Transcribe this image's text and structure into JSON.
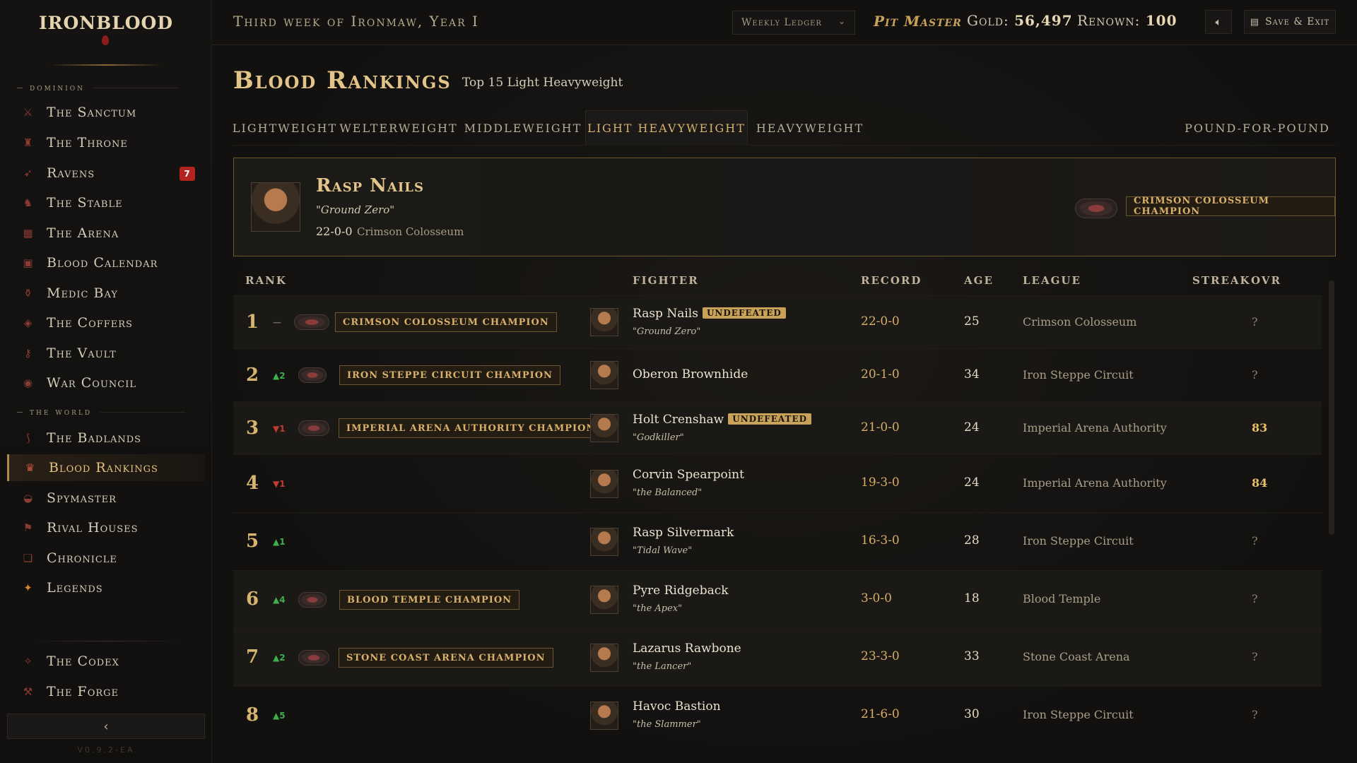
{
  "sidebar": {
    "logo": "IRONBLOOD",
    "sections": [
      {
        "label": "dominion"
      },
      {
        "label": "the world"
      }
    ],
    "items": [
      {
        "label": "The Sanctum",
        "icon": "crossed-swords-icon"
      },
      {
        "label": "The Throne",
        "icon": "throne-icon"
      },
      {
        "label": "Ravens",
        "icon": "raven-icon",
        "badge": "7"
      },
      {
        "label": "The Stable",
        "icon": "horse-icon"
      },
      {
        "label": "The Arena",
        "icon": "arena-icon"
      },
      {
        "label": "Blood Calendar",
        "icon": "calendar-icon"
      },
      {
        "label": "Medic Bay",
        "icon": "potion-icon"
      },
      {
        "label": "The Coffers",
        "icon": "chest-icon"
      },
      {
        "label": "The Vault",
        "icon": "key-icon"
      },
      {
        "label": "War Council",
        "icon": "eye-icon"
      },
      {
        "label": "The Badlands",
        "icon": "claw-icon"
      },
      {
        "label": "Blood Rankings",
        "icon": "trophy-icon",
        "active": true
      },
      {
        "label": "Spymaster",
        "icon": "spy-icon"
      },
      {
        "label": "Rival Houses",
        "icon": "banner-icon"
      },
      {
        "label": "Chronicle",
        "icon": "book-icon"
      },
      {
        "label": "Legends",
        "icon": "star-icon"
      },
      {
        "label": "The Codex",
        "icon": "codex-icon"
      },
      {
        "label": "The Forge",
        "icon": "anvil-icon"
      }
    ],
    "collapse_glyph": "‹",
    "version": "V0.9.2-EA"
  },
  "topbar": {
    "week": "Third week of Ironmaw, Year I",
    "ledger": "Weekly Ledger",
    "role": "Pit Master",
    "gold_label": "Gold:",
    "gold": "56,497",
    "renown_label": "Renown:",
    "renown": "100",
    "sound_icon": "speaker-icon",
    "save_label": "Save & Exit",
    "save_icon": "floppy-icon"
  },
  "page": {
    "title": "Blood Rankings",
    "subtitle": "Top 15 Light Heavyweight"
  },
  "tabs": [
    "LIGHTWEIGHT",
    "WELTERWEIGHT",
    "MIDDLEWEIGHT",
    "LIGHT HEAVYWEIGHT",
    "HEAVYWEIGHT",
    "POUND-FOR-POUND"
  ],
  "active_tab": "LIGHT HEAVYWEIGHT",
  "champion": {
    "name": "Rasp Nails",
    "nickname": "\"Ground Zero\"",
    "record": "22-0-0",
    "league": "Crimson Colosseum",
    "title": "CRIMSON COLOSSEUM CHAMPION"
  },
  "table": {
    "headers": [
      "RANK",
      "FIGHTER",
      "RECORD",
      "AGE",
      "LEAGUE",
      "STREAK",
      "OVR"
    ],
    "rows": [
      {
        "rank": "1",
        "move": "—",
        "title": "CRIMSON COLOSSEUM CHAMPION",
        "name": "Rasp Nails",
        "undefeated": "UNDEFEATED",
        "nickname": "\"Ground Zero\"",
        "record": "22-0-0",
        "age": "25",
        "league": "Crimson Colosseum",
        "ovr": "?"
      },
      {
        "rank": "2",
        "move": "▲2",
        "title": "IRON STEPPE CIRCUIT CHAMPION",
        "name": "Oberon Brownhide",
        "record": "20-1-0",
        "age": "34",
        "league": "Iron Steppe Circuit",
        "ovr": "?"
      },
      {
        "rank": "3",
        "move": "▼1",
        "title": "IMPERIAL ARENA AUTHORITY CHAMPION",
        "name": "Holt Crenshaw",
        "undefeated": "UNDEFEATED",
        "nickname": "\"Godkiller\"",
        "record": "21-0-0",
        "age": "24",
        "league": "Imperial Arena Authority",
        "ovr": "83"
      },
      {
        "rank": "4",
        "move": "▼1",
        "name": "Corvin Spearpoint",
        "nickname": "\"the Balanced\"",
        "record": "19-3-0",
        "age": "24",
        "league": "Imperial Arena Authority",
        "ovr": "84"
      },
      {
        "rank": "5",
        "move": "▲1",
        "name": "Rasp Silvermark",
        "nickname": "\"Tidal Wave\"",
        "record": "16-3-0",
        "age": "28",
        "league": "Iron Steppe Circuit",
        "ovr": "?"
      },
      {
        "rank": "6",
        "move": "▲4",
        "title": "BLOOD TEMPLE CHAMPION",
        "name": "Pyre Ridgeback",
        "nickname": "\"the Apex\"",
        "record": "3-0-0",
        "age": "18",
        "league": "Blood Temple",
        "ovr": "?"
      },
      {
        "rank": "7",
        "move": "▲2",
        "title": "STONE COAST ARENA CHAMPION",
        "name": "Lazarus Rawbone",
        "nickname": "\"the Lancer\"",
        "record": "23-3-0",
        "age": "33",
        "league": "Stone Coast Arena",
        "ovr": "?"
      },
      {
        "rank": "8",
        "move": "▲5",
        "name": "Havoc Bastion",
        "nickname": "\"the Slammer\"",
        "record": "21-6-0",
        "age": "30",
        "league": "Iron Steppe Circuit",
        "ovr": "?"
      }
    ]
  },
  "colors": {
    "accent": "#d7b46f",
    "up": "#3fae4c",
    "down": "#c23b32",
    "badge": "#b3241f"
  }
}
